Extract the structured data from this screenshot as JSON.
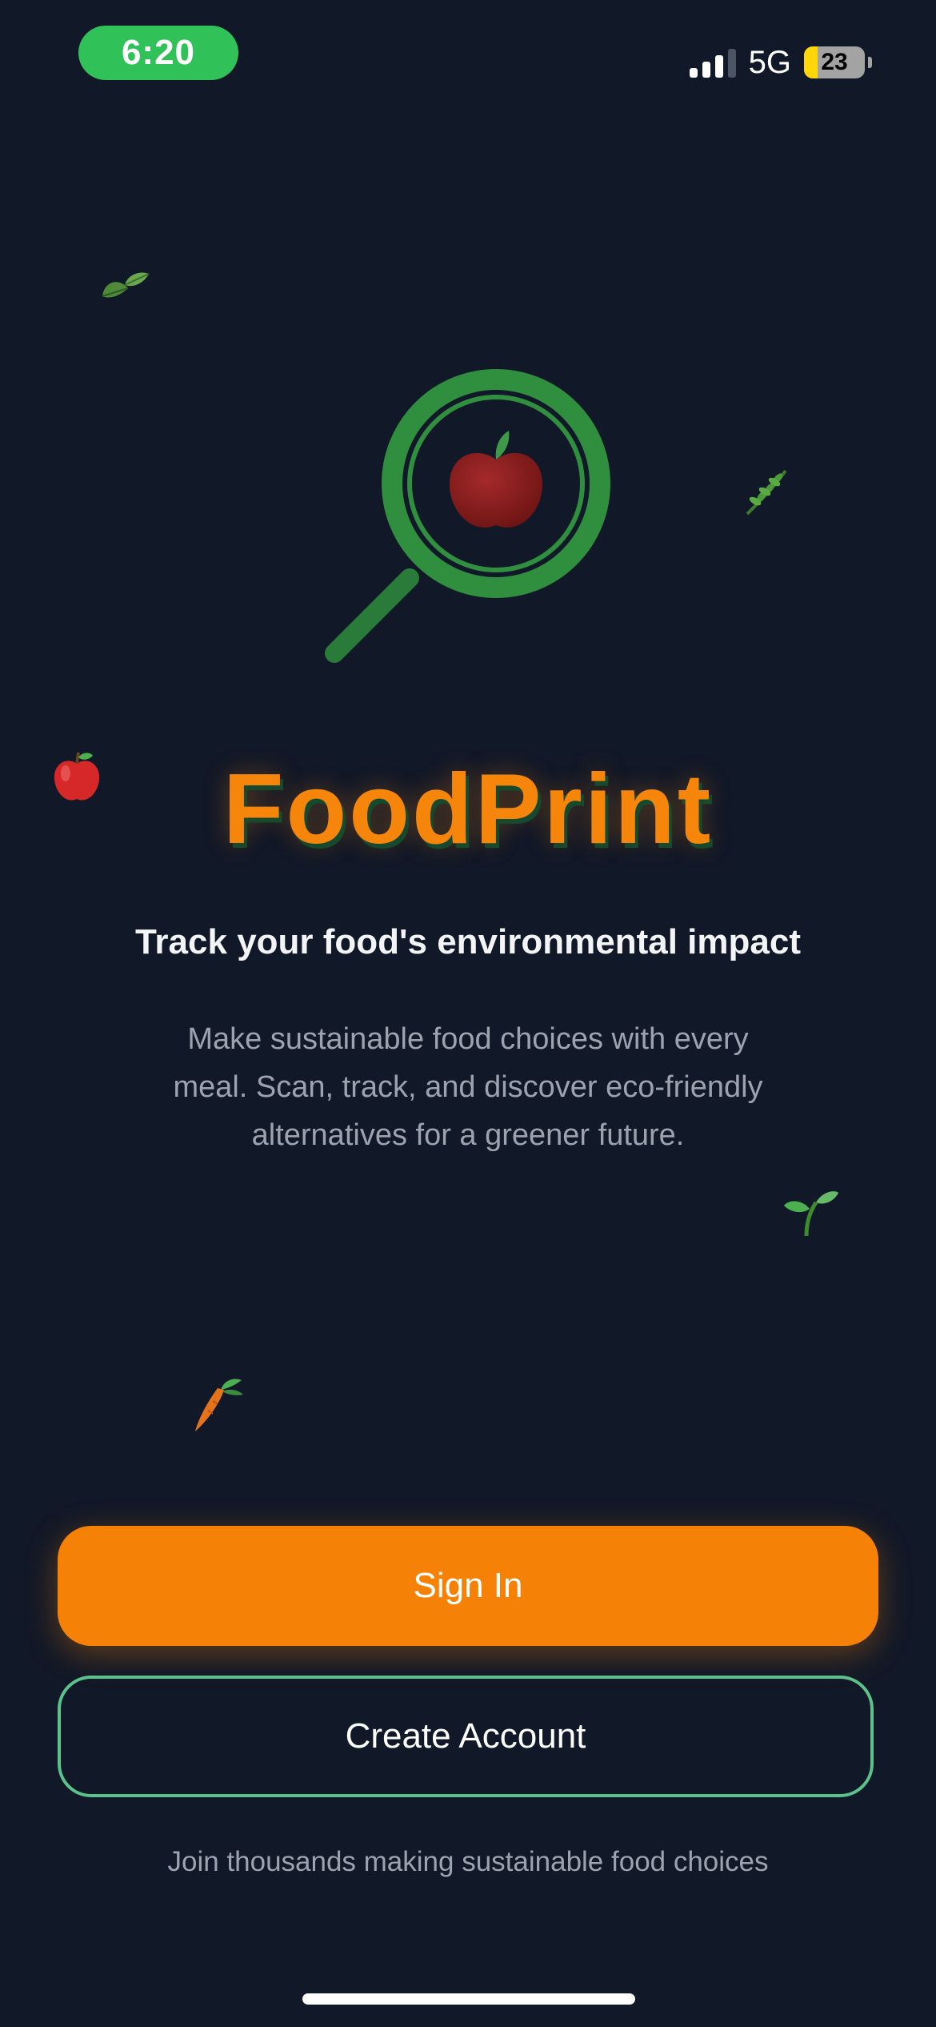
{
  "status_bar": {
    "time": "6:20",
    "network": "5G",
    "battery_level": "23"
  },
  "decorations": [
    "leaves-emoji",
    "herb-emoji",
    "apple-emoji",
    "seedling-emoji",
    "carrot-emoji"
  ],
  "logo": {
    "icon": "magnifier-apple-icon",
    "ring_color": "#2f8f3f",
    "apple_color": "#8b1e1e"
  },
  "app": {
    "name": "FoodPrint",
    "tagline": "Track your food's environmental impact",
    "description": "Make sustainable food choices with every meal. Scan, track, and discover eco-friendly alternatives for a greener future."
  },
  "buttons": {
    "sign_in": "Sign In",
    "create_account": "Create Account"
  },
  "footer": {
    "note": "Join thousands making sustainable food choices"
  },
  "colors": {
    "background": "#111827",
    "accent": "#f58206",
    "green": "#5cc28b"
  }
}
